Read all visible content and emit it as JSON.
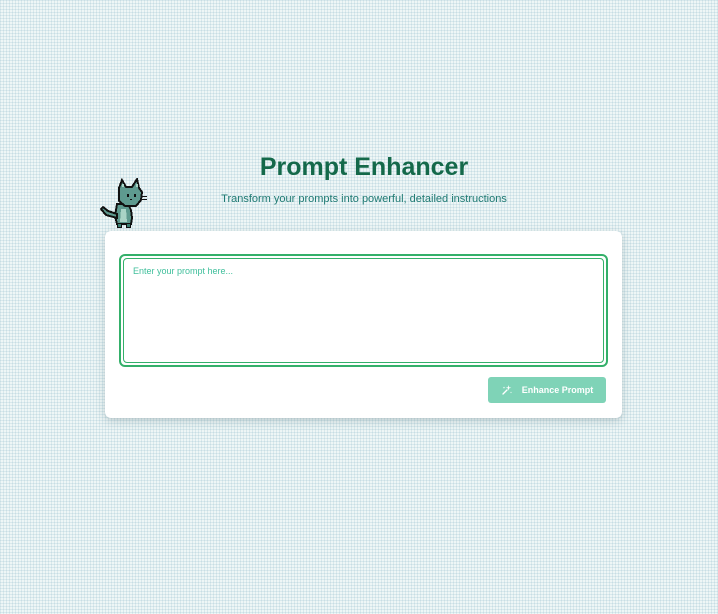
{
  "header": {
    "title": "Prompt Enhancer",
    "subtitle": "Transform your prompts into powerful, detailed instructions"
  },
  "mascot": {
    "icon": "pixel-cat-icon"
  },
  "prompt": {
    "placeholder": "Enter your prompt here...",
    "value": ""
  },
  "actions": {
    "enhance_label": "Enhance Prompt",
    "enhance_icon": "sparkles-icon",
    "enhance_enabled": false
  },
  "colors": {
    "title": "#14694a",
    "subtitle": "#1f7a73",
    "input_border": "#34b06a",
    "placeholder": "#3fbf9b",
    "button_background": "#7fd3b7",
    "page_background": "#eef6f6"
  }
}
